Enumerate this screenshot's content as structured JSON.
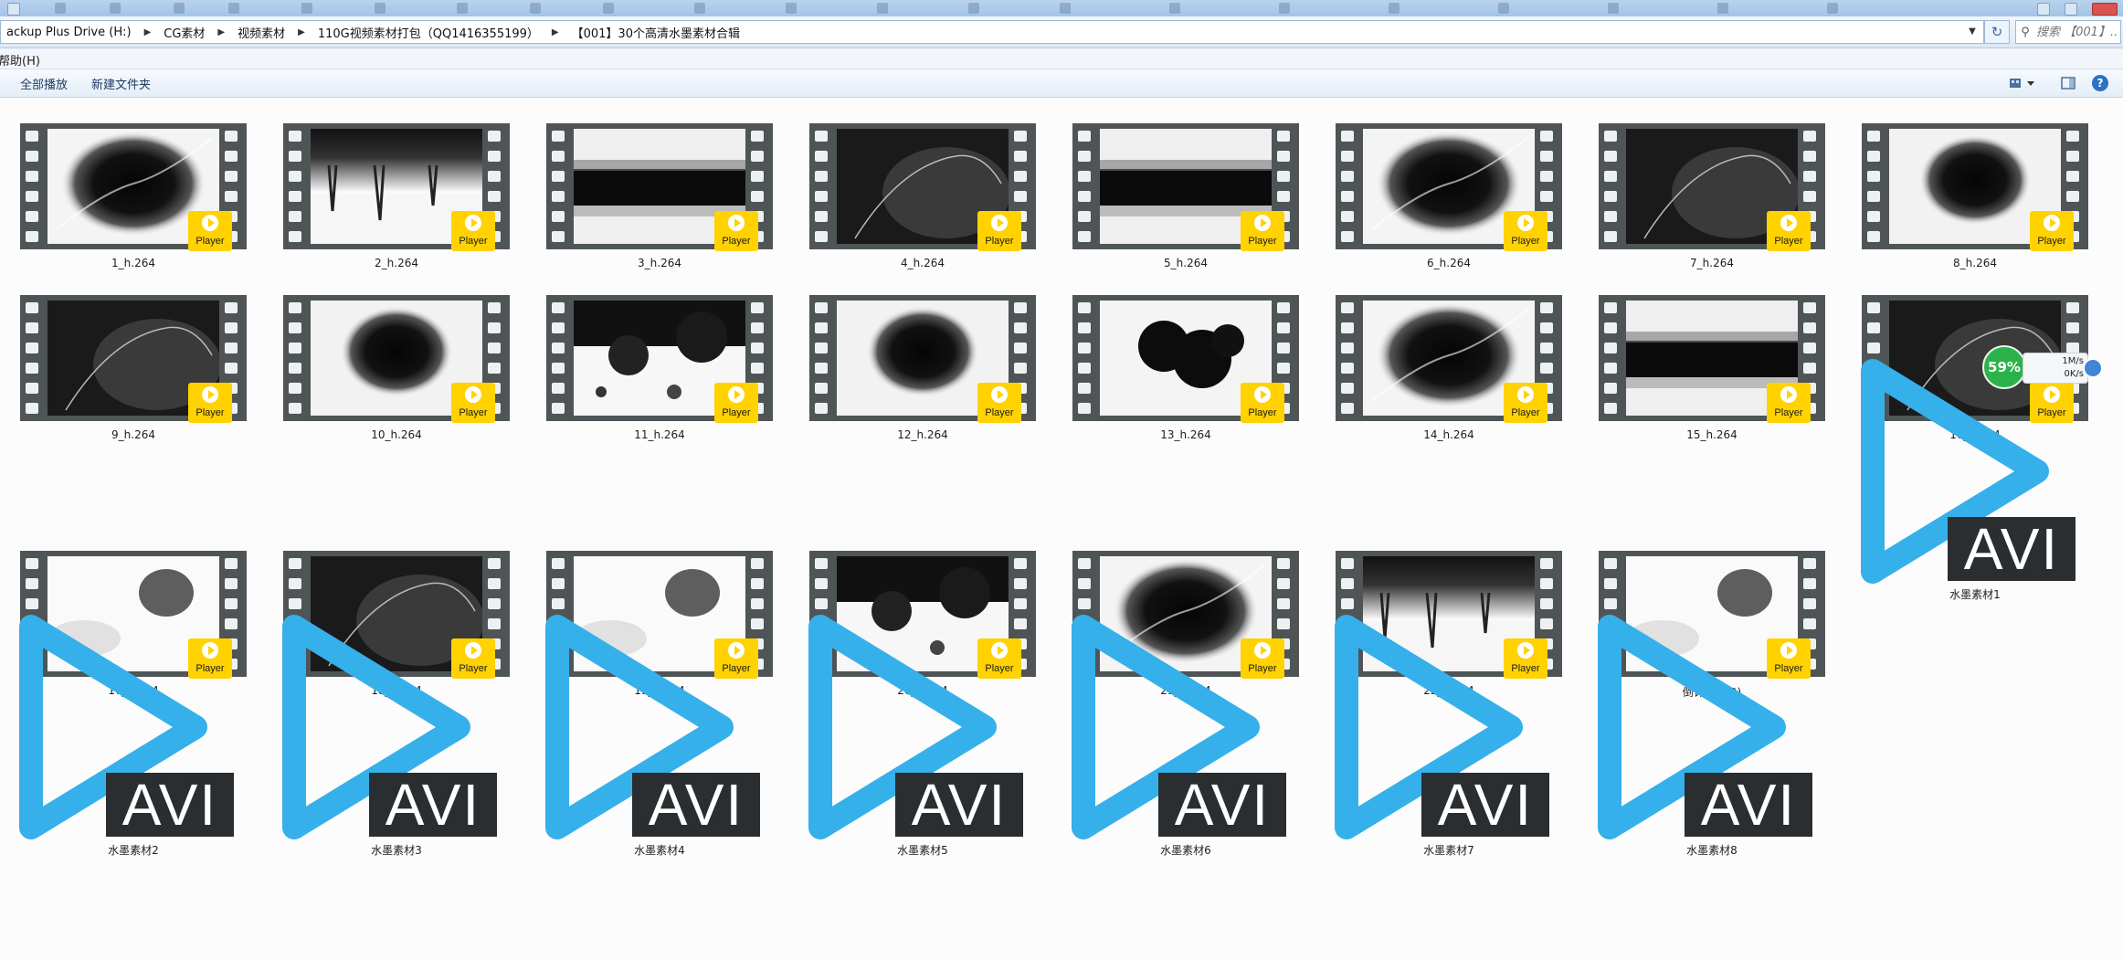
{
  "address": {
    "crumbs": [
      "ackup Plus Drive (H:)",
      "CG素材",
      "视频素材",
      "110G视频素材打包（QQ1416355199）",
      "【001】30个高清水墨素材合辑"
    ],
    "search_placeholder": "搜索 【001】..."
  },
  "menu": {
    "help": "帮助(H)"
  },
  "toolbar": {
    "play_all": "全部播放",
    "new_folder": "新建文件夹",
    "help_glyph": "?"
  },
  "player_badge_label": "Player",
  "avi_label": "AVI",
  "video_files": [
    {
      "name": "1_h.264",
      "pattern": "burst"
    },
    {
      "name": "2_h.264",
      "pattern": "drip"
    },
    {
      "name": "3_h.264",
      "pattern": "band"
    },
    {
      "name": "4_h.264",
      "pattern": "dark"
    },
    {
      "name": "5_h.264",
      "pattern": "band"
    },
    {
      "name": "6_h.264",
      "pattern": "burst"
    },
    {
      "name": "7_h.264",
      "pattern": "dark"
    },
    {
      "name": "8_h.264",
      "pattern": "bloom"
    },
    {
      "name": "9_h.264",
      "pattern": "dark"
    },
    {
      "name": "10_h.264",
      "pattern": "bloom"
    },
    {
      "name": "11_h.264",
      "pattern": "spots"
    },
    {
      "name": "12_h.264",
      "pattern": "bloom"
    },
    {
      "name": "13_h.264",
      "pattern": "blobs"
    },
    {
      "name": "14_h.264",
      "pattern": "burst"
    },
    {
      "name": "15_h.264",
      "pattern": "band"
    },
    {
      "name": "16_h.264",
      "pattern": "dark"
    },
    {
      "name": "17_h.264",
      "pattern": "light"
    },
    {
      "name": "18_h.264",
      "pattern": "dark"
    },
    {
      "name": "19_h.264",
      "pattern": "light"
    },
    {
      "name": "20_h.264",
      "pattern": "spots"
    },
    {
      "name": "21_h.264",
      "pattern": "burst"
    },
    {
      "name": "22_h.264",
      "pattern": "drip"
    },
    {
      "name": "倒计时 (12)",
      "pattern": "light"
    }
  ],
  "avi_files": [
    "水墨素材1",
    "水墨素材2",
    "水墨素材3",
    "水墨素材4",
    "水墨素材5",
    "水墨素材6",
    "水墨素材7",
    "水墨素材8"
  ],
  "network_widget": {
    "percent": "59%",
    "upload": "1M/s",
    "download": "0K/s"
  },
  "colors": {
    "avi_play": "#35b0ea",
    "avi_box": "#2b2e30",
    "badge": "#ffd200",
    "net_green": "#2cb24a"
  }
}
